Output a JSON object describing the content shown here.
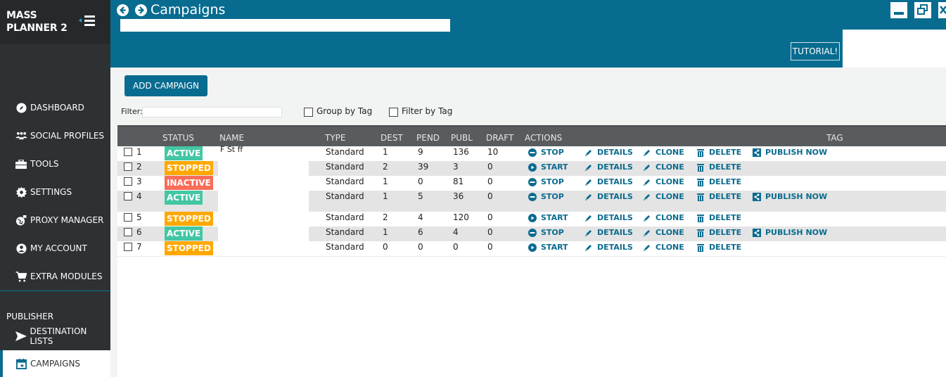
{
  "app": {
    "brand_line1": "MASS",
    "brand_line2": "PLANNER 2",
    "title": "Campaigns"
  },
  "sidebar": {
    "items": [
      {
        "label": "DASHBOARD",
        "icon": "compass-icon"
      },
      {
        "label": "SOCIAL PROFILES",
        "icon": "users-icon"
      },
      {
        "label": "TOOLS",
        "icon": "toolbox-icon"
      },
      {
        "label": "SETTINGS",
        "icon": "gear-icon"
      },
      {
        "label": "PROXY MANAGER",
        "icon": "globe-icon"
      },
      {
        "label": "MY ACCOUNT",
        "icon": "user-circle-icon"
      },
      {
        "label": "EXTRA MODULES",
        "icon": "cart-icon"
      }
    ],
    "section_label": "PUBLISHER",
    "publisher_items": [
      {
        "label": "DESTINATION LISTS",
        "icon": "send-icon"
      },
      {
        "label": "CAMPAIGNS",
        "icon": "calendar-icon",
        "active": true
      }
    ]
  },
  "header": {
    "tutorial_label": "TUTORIAL!"
  },
  "toolbar": {
    "add_campaign_label": "ADD CAMPAIGN",
    "filter_label": "Filter:",
    "filter_value": "",
    "group_by_tag_label": "Group by Tag",
    "filter_by_tag_label": "Filter by Tag"
  },
  "table": {
    "columns": [
      "STATUS",
      "NAME",
      "TYPE",
      "DEST",
      "PEND",
      "PUBL",
      "DRAFT",
      "ACTIONS",
      "TAG"
    ],
    "rows": [
      {
        "id": "1",
        "status": "ACTIVE",
        "name": "F     St  ff",
        "type": "Standard",
        "dest": "1",
        "pend": "9",
        "publ": "136",
        "draft": "10",
        "toggle": "STOP",
        "publish_now": true
      },
      {
        "id": "2",
        "status": "STOPPED",
        "name": "",
        "type": "Standard",
        "dest": "2",
        "pend": "39",
        "publ": "3",
        "draft": "0",
        "toggle": "START",
        "publish_now": false
      },
      {
        "id": "3",
        "status": "INACTIVE",
        "name": "",
        "type": "Standard",
        "dest": "1",
        "pend": "0",
        "publ": "81",
        "draft": "0",
        "toggle": "STOP",
        "publish_now": false
      },
      {
        "id": "4",
        "status": "ACTIVE",
        "name": "",
        "type": "Standard",
        "dest": "1",
        "pend": "5",
        "publ": "36",
        "draft": "0",
        "toggle": "STOP",
        "publish_now": true
      },
      {
        "id": "5",
        "status": "STOPPED",
        "name": "",
        "type": "Standard",
        "dest": "2",
        "pend": "4",
        "publ": "120",
        "draft": "0",
        "toggle": "START",
        "publish_now": false
      },
      {
        "id": "6",
        "status": "ACTIVE",
        "name": "",
        "type": "Standard",
        "dest": "1",
        "pend": "6",
        "publ": "4",
        "draft": "0",
        "toggle": "STOP",
        "publish_now": true
      },
      {
        "id": "7",
        "status": "STOPPED",
        "name": "",
        "type": "Standard",
        "dest": "0",
        "pend": "0",
        "publ": "0",
        "draft": "0",
        "toggle": "START",
        "publish_now": false
      }
    ],
    "actions": {
      "details": "DETAILS",
      "clone": "CLONE",
      "delete": "DELETE",
      "publish_now": "PUBLISH NOW"
    }
  },
  "colors": {
    "accent": "#086c90",
    "sidebar_bg": "#2e3133",
    "status_active": "#43c6a4",
    "status_stopped": "#ffa800",
    "status_inactive": "#f86d58",
    "action_text": "#0a6b8f"
  }
}
